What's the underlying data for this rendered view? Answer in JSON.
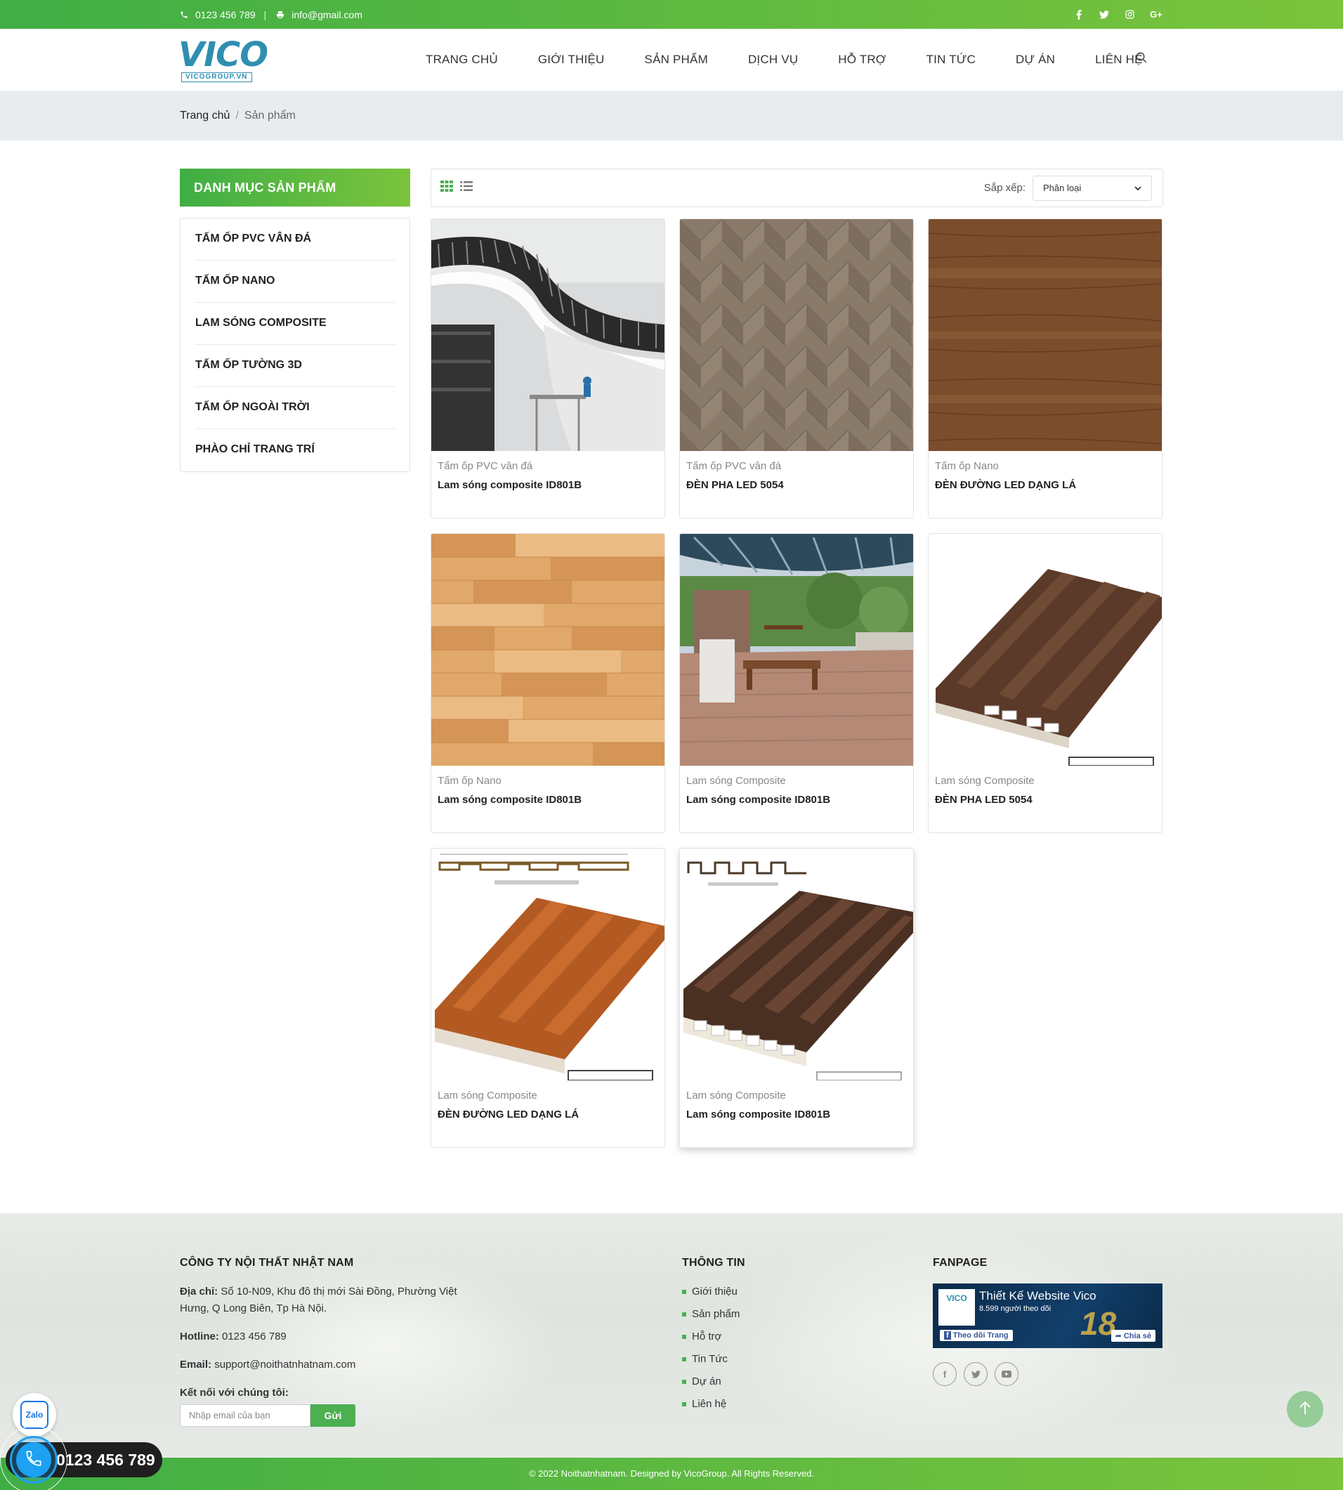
{
  "topbar": {
    "phone": "0123 456 789",
    "separator": "|",
    "email": "info@gmail.com",
    "socials": [
      "facebook-icon",
      "twitter-icon",
      "instagram-icon",
      "google-plus-icon"
    ]
  },
  "logo": {
    "word": "VICO",
    "sub": "VICOGROUP.VN"
  },
  "nav": [
    "TRANG CHỦ",
    "GIỚI THIỆU",
    "SẢN PHẨM",
    "DỊCH VỤ",
    "HỖ TRỢ",
    "TIN TỨC",
    "DỰ ÁN",
    "LIÊN HỆ"
  ],
  "breadcrumb": {
    "home": "Trang chủ",
    "separator": "/",
    "current": "Sản phẩm"
  },
  "sidebar": {
    "title": "DANH MỤC SẢN PHẨM",
    "items": [
      "TẤM ỐP PVC VÂN ĐÁ",
      "TẤM ỐP NANO",
      "LAM SÓNG COMPOSITE",
      "TẤM ỐP TƯỜNG 3D",
      "TẤM ỐP NGOÀI TRỜI",
      "PHÀO CHỈ TRANG TRÍ"
    ]
  },
  "toolbar": {
    "sort_label": "Sắp xếp:",
    "sort_value": "Phân loại"
  },
  "products": [
    {
      "category": "Tấm ốp PVC vân đá",
      "name": "Lam sóng composite ID801B",
      "image": "ceiling-slats"
    },
    {
      "category": "Tấm ốp PVC vân đá",
      "name": "ĐÈN PHA LED 5054",
      "image": "herringbone-wood"
    },
    {
      "category": "Tấm ốp Nano",
      "name": "ĐÈN ĐƯỜNG LED DẠNG LÁ",
      "image": "dark-wood"
    },
    {
      "category": "Tấm ốp Nano",
      "name": "Lam sóng composite ID801B",
      "image": "light-wood"
    },
    {
      "category": "Lam sóng Composite",
      "name": "Lam sóng composite ID801B",
      "image": "outdoor-deck"
    },
    {
      "category": "Lam sóng Composite",
      "name": "ĐÈN PHA LED 5054",
      "image": "brown-panel"
    },
    {
      "category": "Lam sóng Composite",
      "name": "ĐÈN ĐƯỜNG LED DẠNG LÁ",
      "image": "orange-panel"
    },
    {
      "category": "Lam sóng Composite",
      "name": "Lam sóng composite ID801B",
      "image": "dark-panel"
    }
  ],
  "footer": {
    "company": {
      "title": "CÔNG TY NỘI THẤT NHẬT NAM",
      "address_label": "Địa chỉ:",
      "address": "Số 10-N09, Khu đô thị mới Sài Đồng, Phường Việt Hưng, Q Long Biên, Tp Hà Nội.",
      "hotline_label": "Hotline:",
      "hotline": "0123 456 789",
      "email_label": "Email:",
      "email": "support@noithatnhatnam.com",
      "connect_label": "Kết nối với chúng tôi:",
      "email_placeholder": "Nhập email của bạn",
      "send_label": "Gửi"
    },
    "info": {
      "title": "THÔNG TIN",
      "links": [
        "Giới thiệu",
        "Sản phẩm",
        "Hỗ trợ",
        "Tin Tức",
        "Dự án",
        "Liên hệ"
      ]
    },
    "fanpage": {
      "title": "FANPAGE",
      "page_name": "Thiết Kế Website Vico",
      "followers": "8.599 người theo dõi",
      "follow_btn": "Theo dõi Trang",
      "share_btn": "Chia sẻ",
      "socials": [
        "facebook-icon",
        "twitter-icon",
        "youtube-icon"
      ]
    },
    "copyright": "© 2022 Noithatnhatnam. Designed by VicoGroup. All Rights Reserved."
  },
  "floating": {
    "zalo": "Zalo",
    "hotline": "0123 456 789"
  },
  "colors": {
    "green_start": "#3fae45",
    "green_end": "#7bc43c",
    "phone_blue": "#1da1f2"
  }
}
